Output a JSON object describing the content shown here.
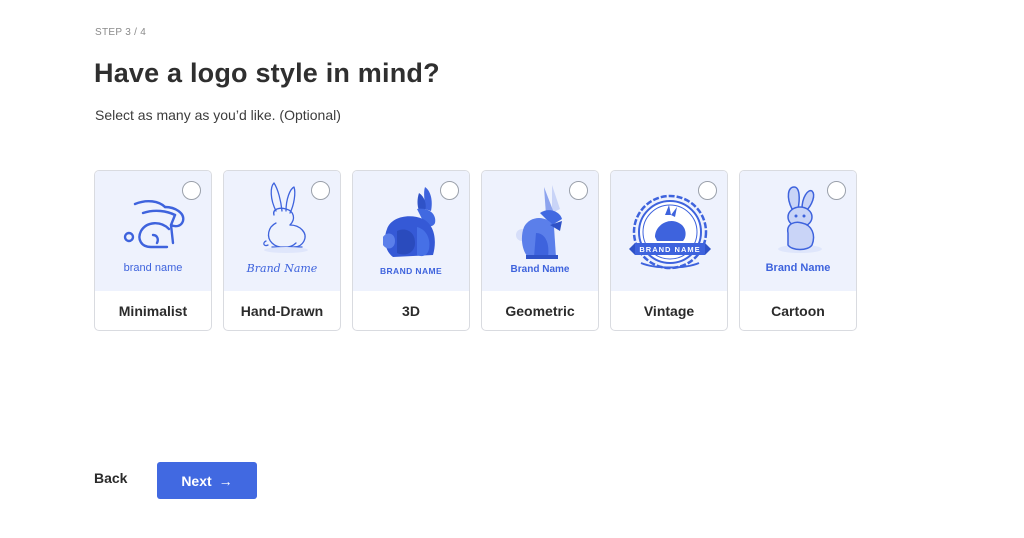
{
  "header": {
    "step": "STEP 3 / 4",
    "title": "Have a logo style in mind?",
    "subtitle": "Select as many as you’d like. (Optional)"
  },
  "styles": [
    {
      "label": "Minimalist",
      "brand": "brand name",
      "icon": "rabbit-line-icon",
      "selected": false
    },
    {
      "label": "Hand-Drawn",
      "brand": "Brand Name",
      "icon": "rabbit-sketch-icon",
      "selected": false
    },
    {
      "label": "3D",
      "brand": "BRAND NAME",
      "icon": "rabbit-3d-icon",
      "selected": false
    },
    {
      "label": "Geometric",
      "brand": "Brand Name",
      "icon": "rabbit-geometric-icon",
      "selected": false
    },
    {
      "label": "Vintage",
      "brand": "BRAND NAME",
      "icon": "rabbit-badge-icon",
      "selected": false
    },
    {
      "label": "Cartoon",
      "brand": "Brand Name",
      "icon": "rabbit-cartoon-icon",
      "selected": false
    }
  ],
  "footer": {
    "back_label": "Back",
    "next_label": "Next",
    "next_icon": "arrow-right-icon"
  },
  "colors": {
    "accent": "#4169e1",
    "preview_bg": "#eef2fd",
    "logo_blue": "#3e63dd"
  }
}
